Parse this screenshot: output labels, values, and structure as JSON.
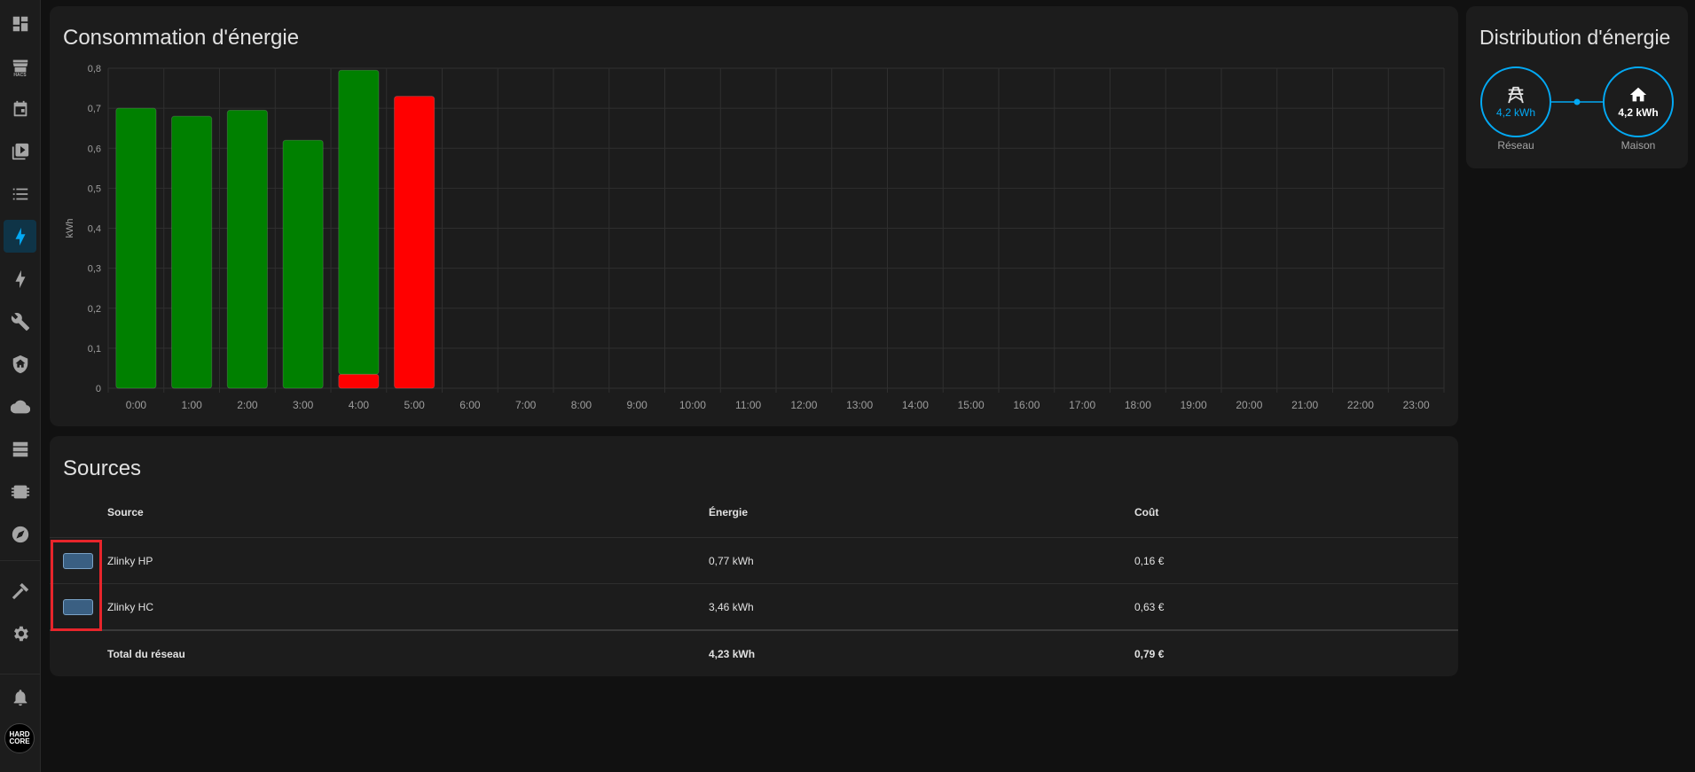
{
  "sidebar": {
    "items": [
      {
        "name": "overview",
        "icon": "dashboard-icon"
      },
      {
        "name": "hacs",
        "icon": "store-icon",
        "label": "HACS"
      },
      {
        "name": "calendar",
        "icon": "calendar-icon"
      },
      {
        "name": "media",
        "icon": "media-icon"
      },
      {
        "name": "todo",
        "icon": "list-icon"
      },
      {
        "name": "energy",
        "icon": "lightning-icon",
        "active": true
      },
      {
        "name": "energy-alt",
        "icon": "lightning-outline-icon"
      },
      {
        "name": "tools",
        "icon": "wrench-icon"
      },
      {
        "name": "security",
        "icon": "shield-home-icon"
      },
      {
        "name": "cloud",
        "icon": "cloud-icon"
      },
      {
        "name": "servers",
        "icon": "server-icon"
      },
      {
        "name": "chip",
        "icon": "chip-icon"
      },
      {
        "name": "compass",
        "icon": "compass-icon"
      },
      {
        "name": "developer",
        "icon": "hammer-icon"
      },
      {
        "name": "settings",
        "icon": "gear-icon"
      },
      {
        "name": "notifications",
        "icon": "bell-icon"
      }
    ],
    "avatar_text": "HARD CORE"
  },
  "consumption": {
    "title": "Consommation d'énergie",
    "chart_data": {
      "type": "bar",
      "stacked": true,
      "categories": [
        "0:00",
        "1:00",
        "2:00",
        "3:00",
        "4:00",
        "5:00",
        "6:00",
        "7:00",
        "8:00",
        "9:00",
        "10:00",
        "11:00",
        "12:00",
        "13:00",
        "14:00",
        "15:00",
        "16:00",
        "17:00",
        "18:00",
        "19:00",
        "20:00",
        "21:00",
        "22:00",
        "23:00"
      ],
      "series": [
        {
          "color": "#ff0000",
          "values": [
            0,
            0,
            0,
            0,
            0.035,
            0.73,
            0,
            0,
            0,
            0,
            0,
            0,
            0,
            0,
            0,
            0,
            0,
            0,
            0,
            0,
            0,
            0,
            0,
            0
          ]
        },
        {
          "color": "#008000",
          "values": [
            0.7,
            0.68,
            0.695,
            0.62,
            0.76,
            0,
            0,
            0,
            0,
            0,
            0,
            0,
            0,
            0,
            0,
            0,
            0,
            0,
            0,
            0,
            0,
            0,
            0,
            0
          ]
        }
      ],
      "ylabel": "kWh",
      "ylim": [
        0,
        0.8
      ],
      "yticks": [
        "0",
        "0,1",
        "0,2",
        "0,3",
        "0,4",
        "0,5",
        "0,6",
        "0,7",
        "0,8"
      ],
      "grid": true
    }
  },
  "distribution": {
    "title": "Distribution d'énergie",
    "grid": {
      "value": "4,2 kWh",
      "label": "Réseau",
      "icon": "transmission-tower-icon",
      "color": "#03a9f4"
    },
    "home": {
      "value": "4,2 kWh",
      "label": "Maison",
      "icon": "home-icon"
    }
  },
  "sources": {
    "title": "Sources",
    "headers": {
      "source": "Source",
      "energy": "Énergie",
      "cost": "Coût"
    },
    "rows": [
      {
        "name": "Zlinky HP",
        "energy": "0,77 kWh",
        "cost": "0,16 €"
      },
      {
        "name": "Zlinky HC",
        "energy": "3,46 kWh",
        "cost": "0,63 €"
      }
    ],
    "total": {
      "name": "Total du réseau",
      "energy": "4,23 kWh",
      "cost": "0,79 €"
    }
  }
}
